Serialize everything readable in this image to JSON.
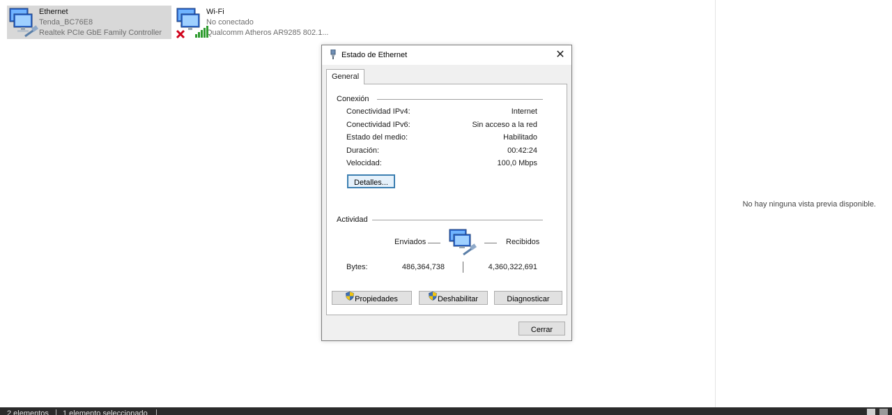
{
  "adapters": [
    {
      "name": "Ethernet",
      "network": "Tenda_BC76E8",
      "device": "Realtek PCIe GbE Family Controller",
      "selected": true
    },
    {
      "name": "Wi-Fi",
      "network": "No conectado",
      "device": "Qualcomm Atheros AR9285 802.1..."
    }
  ],
  "preview": {
    "message": "No hay ninguna vista previa disponible."
  },
  "dialog": {
    "title": "Estado de Ethernet",
    "close_glyph": "✕",
    "tab": "General",
    "connection": {
      "heading": "Conexión",
      "rows": [
        {
          "label": "Conectividad IPv4:",
          "value": "Internet"
        },
        {
          "label": "Conectividad IPv6:",
          "value": "Sin acceso a la red"
        },
        {
          "label": "Estado del medio:",
          "value": "Habilitado"
        },
        {
          "label": "Duración:",
          "value": "00:42:24"
        },
        {
          "label": "Velocidad:",
          "value": "100,0 Mbps"
        }
      ],
      "details_button": "Detalles..."
    },
    "activity": {
      "heading": "Actividad",
      "sent_label": "Enviados",
      "received_label": "Recibidos",
      "bytes_label": "Bytes:",
      "bytes_sent": "486,364,738",
      "bytes_received": "4,360,322,691"
    },
    "buttons": {
      "properties": "Propiedades",
      "disable": "Deshabilitar",
      "diagnose": "Diagnosticar",
      "close": "Cerrar"
    }
  },
  "status_bar": {
    "items_count": "2 elementos",
    "selected_count": "1 elemento seleccionado"
  },
  "colors": {
    "selection": "#d9d9d9",
    "focus_border": "#3c7fb1",
    "status_bar": "#2b2b2b",
    "error_x": "#d0021b",
    "signal": "#2e9b2e"
  }
}
